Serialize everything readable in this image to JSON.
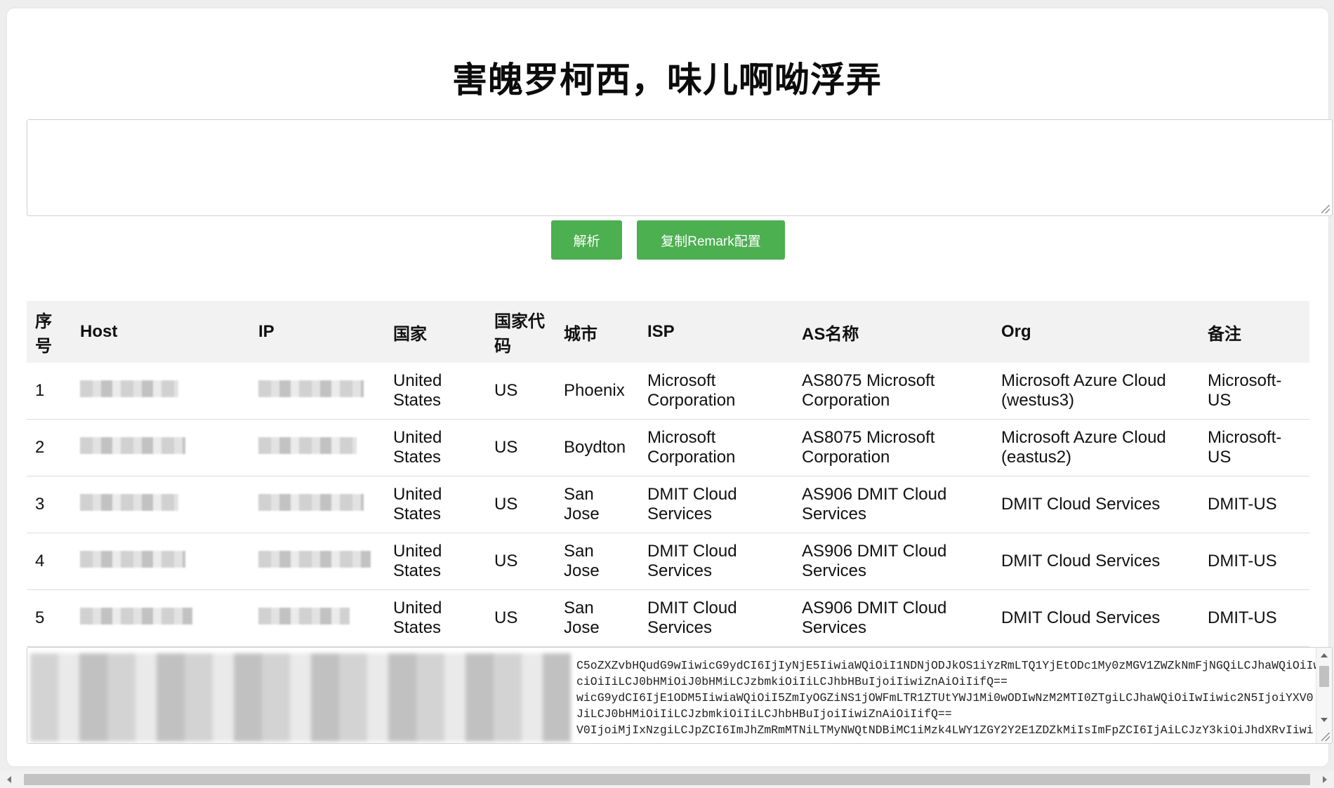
{
  "title": "害魄罗柯西，味儿啊呦浮弄",
  "input": {
    "value": ""
  },
  "buttons": {
    "parse": "解析",
    "copy_remark": "复制Remark配置"
  },
  "table": {
    "headers": [
      "序号",
      "Host",
      "IP",
      "国家",
      "国家代码",
      "城市",
      "ISP",
      "AS名称",
      "Org",
      "备注"
    ],
    "rows": [
      {
        "index": "1",
        "country": "United States",
        "country_code": "US",
        "city": "Phoenix",
        "isp": "Microsoft Corporation",
        "as_name": "AS8075 Microsoft Corporation",
        "org": "Microsoft Azure Cloud (westus3)",
        "remark": "Microsoft-US"
      },
      {
        "index": "2",
        "country": "United States",
        "country_code": "US",
        "city": "Boydton",
        "isp": "Microsoft Corporation",
        "as_name": "AS8075 Microsoft Corporation",
        "org": "Microsoft Azure Cloud (eastus2)",
        "remark": "Microsoft-US"
      },
      {
        "index": "3",
        "country": "United States",
        "country_code": "US",
        "city": "San Jose",
        "isp": "DMIT Cloud Services",
        "as_name": "AS906 DMIT Cloud Services",
        "org": "DMIT Cloud Services",
        "remark": "DMIT-US"
      },
      {
        "index": "4",
        "country": "United States",
        "country_code": "US",
        "city": "San Jose",
        "isp": "DMIT Cloud Services",
        "as_name": "AS906 DMIT Cloud Services",
        "org": "DMIT Cloud Services",
        "remark": "DMIT-US"
      },
      {
        "index": "5",
        "country": "United States",
        "country_code": "US",
        "city": "San Jose",
        "isp": "DMIT Cloud Services",
        "as_name": "AS906 DMIT Cloud Services",
        "org": "DMIT Cloud Services",
        "remark": "DMIT-US"
      }
    ]
  },
  "output": {
    "lines": [
      "C5oZXZvbHQudG9wIiwicG9ydCI6IjIyNjE5IiwiaWQiOiI1NDNjODJkOS1iYzRmLTQ1YjEtODc1My0zMGV1ZWZkNmFjNGQiLCJhaWQiOiIw",
      "ciOiIiLCJ0bHMiOiJ0bHMiLCJzbmkiOiIiLCJhbHBuIjoiIiwiZnAiOiIifQ==",
      "wicG9ydCI6IjE1ODM5IiwiaWQiOiI5ZmIyOGZiNS1jOWFmLTR1ZTUtYWJ1Mi0wODIwNzM2MTI0ZTgiLCJhaWQiOiIwIiwic2N5IjoiYXV0",
      "JiLCJ0bHMiOiIiLCJzbmkiOiIiLCJhbHBuIjoiIiwiZnAiOiIifQ==",
      "V0IjoiMjIxNzgiLCJpZCI6ImJhZmRmMTNiLTMyNWQtNDBiMC1iMzk4LWY1ZGY2Y2E1ZDZkMiIsImFpZCI6IjAiLCJzY3kiOiJhdXRvIiwi"
    ]
  }
}
